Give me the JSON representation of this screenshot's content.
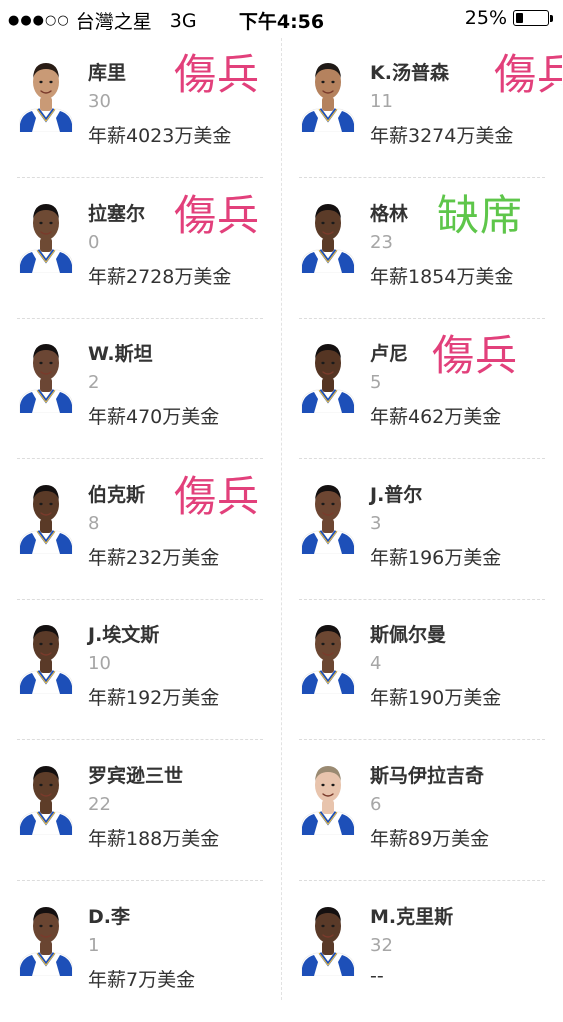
{
  "status_bar": {
    "signal": "●●●○○",
    "carrier": "台灣之星",
    "network": "3G",
    "time": "下午4:56",
    "battery_percent_text": "25%",
    "battery_level": 0.25
  },
  "colors": {
    "injured_stamp": "#e2407b",
    "absent_stamp": "#5ec64a",
    "jersey": "#1d4fb8",
    "jersey_trim": "#f6c23a"
  },
  "players": [
    {
      "name": "库里",
      "number": "30",
      "salary": "年薪4023万美金",
      "status": "傷兵",
      "status_type": "injured",
      "skin": "#c99a76",
      "hair": "#2a1d16"
    },
    {
      "name": "K.汤普森",
      "number": "11",
      "salary": "年薪3274万美金",
      "status": "傷兵",
      "status_type": "injured",
      "skin": "#b5825e",
      "hair": "#1f1a17"
    },
    {
      "name": "拉塞尔",
      "number": "0",
      "salary": "年薪2728万美金",
      "status": "傷兵",
      "status_type": "injured",
      "skin": "#6e4a34",
      "hair": "#141010"
    },
    {
      "name": "格林",
      "number": "23",
      "salary": "年薪1854万美金",
      "status": "缺席",
      "status_type": "absent",
      "skin": "#5b3b28",
      "hair": "#141010"
    },
    {
      "name": "W.斯坦",
      "number": "2",
      "salary": "年薪470万美金",
      "status": "",
      "status_type": "",
      "skin": "#6b4634",
      "hair": "#141010"
    },
    {
      "name": "卢尼",
      "number": "5",
      "salary": "年薪462万美金",
      "status": "傷兵",
      "status_type": "injured",
      "skin": "#553523",
      "hair": "#141010"
    },
    {
      "name": "伯克斯",
      "number": "8",
      "salary": "年薪232万美金",
      "status": "傷兵",
      "status_type": "injured",
      "skin": "#5a3a27",
      "hair": "#141010"
    },
    {
      "name": "J.普尔",
      "number": "3",
      "salary": "年薪196万美金",
      "status": "",
      "status_type": "",
      "skin": "#6d4632",
      "hair": "#141010"
    },
    {
      "name": "J.埃文斯",
      "number": "10",
      "salary": "年薪192万美金",
      "status": "",
      "status_type": "",
      "skin": "#5a3a28",
      "hair": "#141010"
    },
    {
      "name": "斯佩尔曼",
      "number": "4",
      "salary": "年薪190万美金",
      "status": "",
      "status_type": "",
      "skin": "#6c4732",
      "hair": "#141010"
    },
    {
      "name": "罗宾逊三世",
      "number": "22",
      "salary": "年薪188万美金",
      "status": "",
      "status_type": "",
      "skin": "#5e3d29",
      "hair": "#141010"
    },
    {
      "name": "斯马伊拉吉奇",
      "number": "6",
      "salary": "年薪89万美金",
      "status": "",
      "status_type": "",
      "skin": "#e8c4ad",
      "hair": "#9a8a72"
    },
    {
      "name": "D.李",
      "number": "1",
      "salary": "年薪7万美金",
      "status": "",
      "status_type": "",
      "skin": "#6a4531",
      "hair": "#141010"
    },
    {
      "name": "M.克里斯",
      "number": "32",
      "salary": "--",
      "status": "",
      "status_type": "",
      "skin": "#5a3a28",
      "hair": "#141010"
    }
  ]
}
